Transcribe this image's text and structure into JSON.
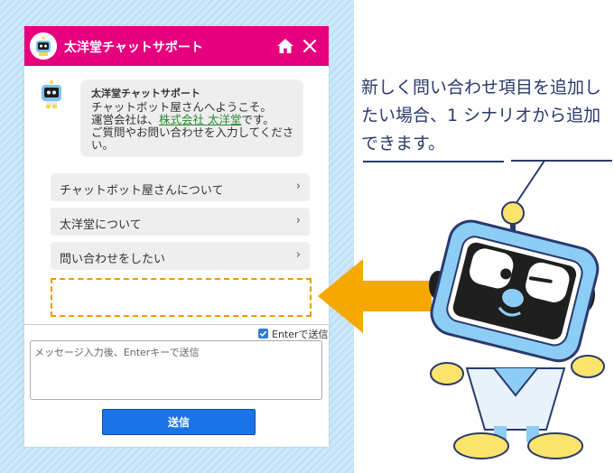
{
  "header": {
    "title": "太洋堂チャットサポート"
  },
  "message": {
    "sender": "太洋堂チャットサポート",
    "line1": "チャットボット屋さんへようこそ。",
    "line2_prefix": "運営会社は、",
    "line2_link": "株式会社 太洋堂",
    "line2_suffix": "です。",
    "line3": "ご質問やお問い合わせを入力してください。"
  },
  "choices": [
    {
      "label": "チャットボット屋さんについて",
      "arrow": "›"
    },
    {
      "label": "太洋堂について",
      "arrow": "›"
    },
    {
      "label": "問い合わせをしたい",
      "arrow": "›"
    }
  ],
  "composer": {
    "enter_to_send_label": "Enterで送信",
    "enter_to_send_checked": true,
    "placeholder": "メッセージ入力後、Enterキーで送信",
    "send_label": "送信"
  },
  "note": "新しく問い合わせ項目を追加したい場合、1 シナリオから追加できます。",
  "colors": {
    "header": "#e6007e",
    "send": "#1a73e8",
    "dashed": "#f39800",
    "arrow": "#f5a800",
    "link": "#2c8a35"
  },
  "icons": [
    "home-icon",
    "close-icon",
    "check-icon",
    "chevron-right-icon",
    "robot-avatar-icon"
  ]
}
